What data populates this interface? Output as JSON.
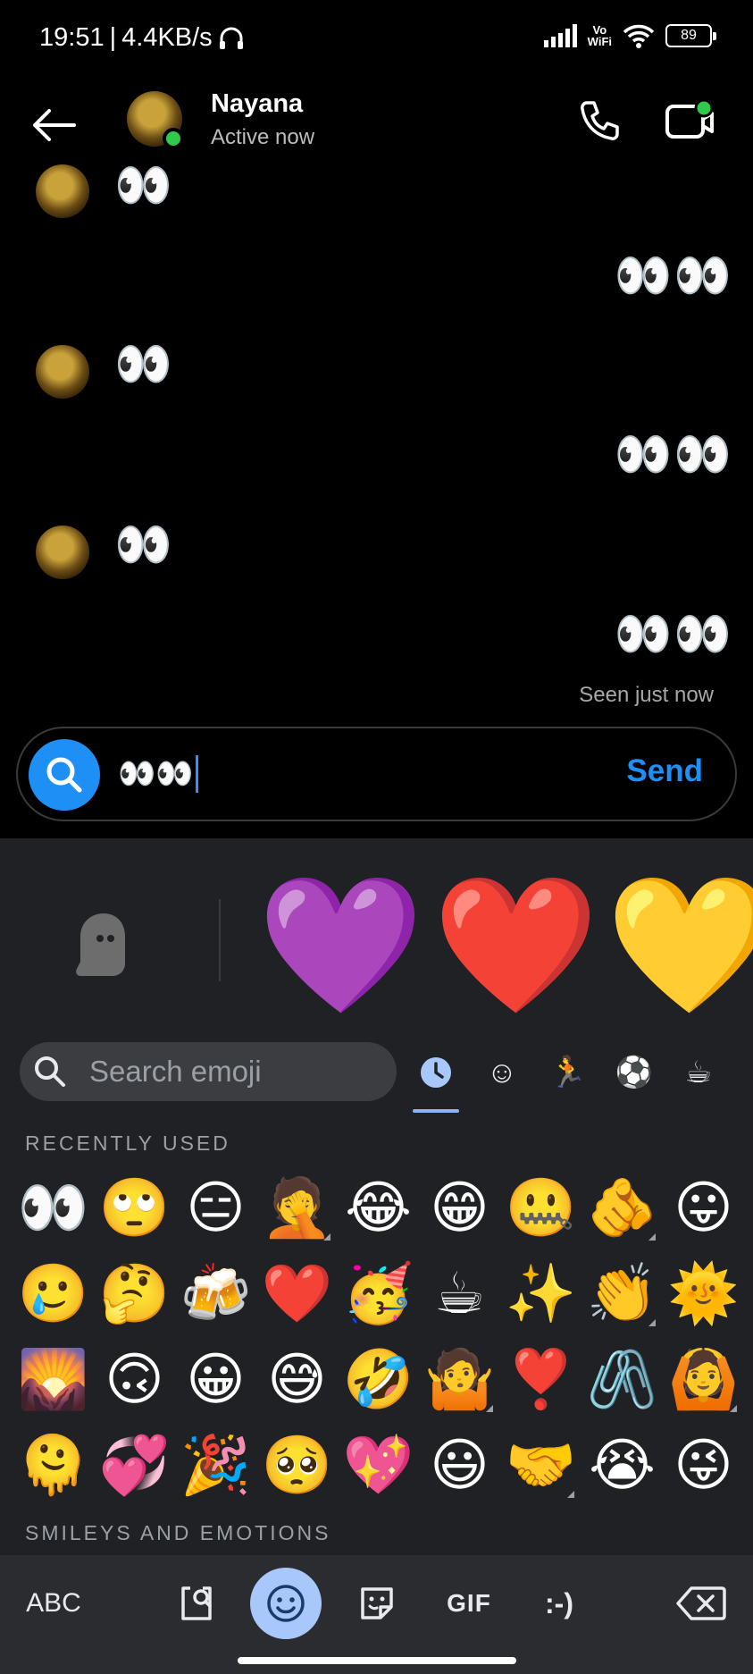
{
  "status_bar": {
    "time": "19:51",
    "network_speed": "4.4KB/s",
    "vowifi_top": "Vo",
    "vowifi_bottom": "WiFi",
    "battery": "89"
  },
  "header": {
    "name": "Nayana",
    "status": "Active now"
  },
  "messages": [
    {
      "side": "left",
      "text": "👀"
    },
    {
      "side": "right",
      "text": "👀👀"
    },
    {
      "side": "left",
      "text": "👀"
    },
    {
      "side": "right",
      "text": "👀👀"
    },
    {
      "side": "left",
      "text": "👀"
    },
    {
      "side": "right",
      "text": "👀👀"
    }
  ],
  "seen_label": "Seen just now",
  "composer": {
    "value": "👀👀",
    "send_label": "Send"
  },
  "stickers": [
    "💜",
    "❤️",
    "💛"
  ],
  "emoji_search": {
    "placeholder": "Search emoji"
  },
  "category_tabs": [
    "🕒",
    "☺",
    "🏃",
    "⚽",
    "☕"
  ],
  "sections": {
    "recent": "RECENTLY USED",
    "smileys": "SMILEYS AND EMOTIONS"
  },
  "recent_emojis": [
    "👀",
    "🙄",
    "😑",
    "🤦",
    "😂",
    "😁",
    "🤐",
    "🫵",
    "😛",
    "🥲",
    "🤔",
    "🍻",
    "❤️",
    "🥳",
    "☕",
    "✨",
    "👏",
    "🌞",
    "🌄",
    "🙃",
    "😀",
    "😅",
    "🤣",
    "🤷",
    "❣️",
    "🖇️",
    "🙆",
    "🫠",
    "💞",
    "🎉",
    "🥺",
    "💖",
    "😃",
    "🤝",
    "😭",
    "😜"
  ],
  "keyboard": {
    "abc": "ABC",
    "gif": "GIF",
    "emoticon": ":-)"
  },
  "colors": {
    "accent": "#1E90F5",
    "online": "#31C94B",
    "keyboard_bg": "#202124",
    "selected_key": "#A8C7FA"
  }
}
